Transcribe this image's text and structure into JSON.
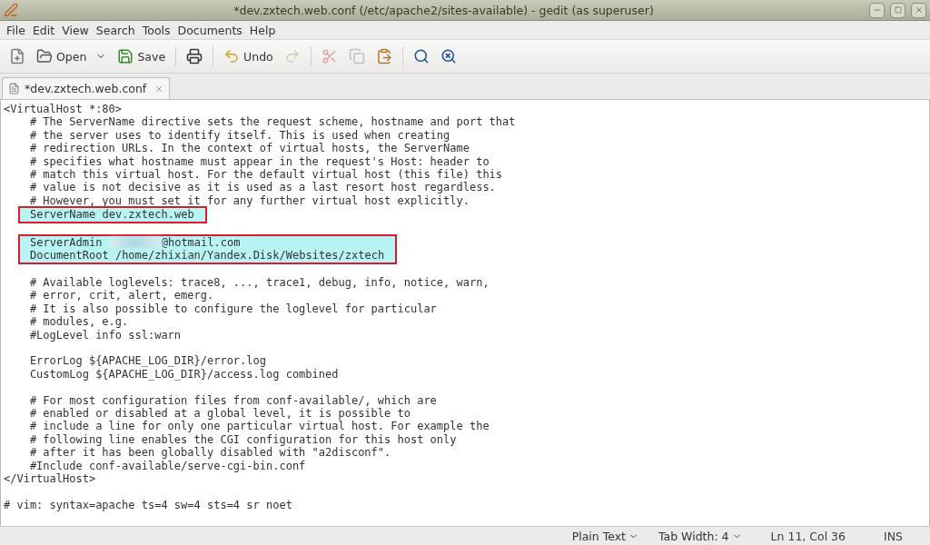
{
  "window": {
    "title": "*dev.zxtech.web.conf (/etc/apache2/sites-available) - gedit (as superuser)"
  },
  "menu": [
    "File",
    "Edit",
    "View",
    "Search",
    "Tools",
    "Documents",
    "Help"
  ],
  "toolbar": [
    {
      "kind": "new",
      "disabled": false
    },
    {
      "kind": "open",
      "label": "Open",
      "disabled": false
    },
    {
      "kind": "save",
      "label": "Save",
      "disabled": false
    },
    {
      "kind": "print",
      "disabled": false
    },
    {
      "kind": "undo",
      "label": "Undo",
      "disabled": false
    },
    {
      "kind": "redo",
      "disabled": true
    },
    {
      "kind": "cut",
      "disabled": true
    },
    {
      "kind": "copy",
      "disabled": true
    },
    {
      "kind": "paste",
      "disabled": false
    },
    {
      "kind": "find",
      "disabled": false
    },
    {
      "kind": "replace",
      "disabled": false
    }
  ],
  "tabs": [
    {
      "label": "*dev.zxtech.web.conf",
      "selected": true
    }
  ],
  "editor": {
    "blocks": [
      {
        "kind": "plain",
        "lines": [
          {
            "text": "<VirtualHost *:80>"
          },
          {
            "text": "    # The ServerName directive sets the request scheme, hostname and port that"
          },
          {
            "text": "    # the server uses to identify itself. This is used when creating"
          },
          {
            "text": "    # redirection URLs. In the context of virtual hosts, the ServerName"
          },
          {
            "text": "    # specifies what hostname must appear in the request's Host: header to"
          },
          {
            "text": "    # match this virtual host. For the default virtual host (this file) this"
          },
          {
            "text": "    # value is not decisive as it is used as a last resort host regardless."
          },
          {
            "text": "    # However, you must set it for any further virtual host explicitly."
          }
        ]
      },
      {
        "kind": "marked",
        "lines": [
          {
            "text": "ServerName dev.zxtech.web"
          }
        ]
      },
      {
        "kind": "plain",
        "lines": [
          {
            "kind": "blank"
          }
        ]
      },
      {
        "kind": "marked",
        "lines": [
          {
            "kind": "redacted",
            "before": "ServerAdmin ",
            "after": "@hotmail.com"
          },
          {
            "text": "DocumentRoot /home/zhixian/Yandex.Disk/Websites/zxtech"
          }
        ]
      },
      {
        "kind": "plain",
        "lines": [
          {
            "kind": "blank"
          },
          {
            "text": "    # Available loglevels: trace8, ..., trace1, debug, info, notice, warn,"
          },
          {
            "text": "    # error, crit, alert, emerg."
          },
          {
            "text": "    # It is also possible to configure the loglevel for particular"
          },
          {
            "text": "    # modules, e.g."
          },
          {
            "text": "    #LogLevel info ssl:warn"
          },
          {
            "kind": "blank"
          },
          {
            "text": "    ErrorLog ${APACHE_LOG_DIR}/error.log"
          },
          {
            "text": "    CustomLog ${APACHE_LOG_DIR}/access.log combined"
          },
          {
            "kind": "blank"
          },
          {
            "text": "    # For most configuration files from conf-available/, which are"
          },
          {
            "text": "    # enabled or disabled at a global level, it is possible to"
          },
          {
            "text": "    # include a line for only one particular virtual host. For example the"
          },
          {
            "text": "    # following line enables the CGI configuration for this host only"
          },
          {
            "text": "    # after it has been globally disabled with \"a2disconf\"."
          },
          {
            "text": "    #Include conf-available/serve-cgi-bin.conf"
          },
          {
            "text": "</VirtualHost>"
          },
          {
            "kind": "blank"
          },
          {
            "text": "# vim: syntax=apache ts=4 sw=4 sts=4 sr noet"
          }
        ]
      }
    ]
  },
  "status_bar": {
    "language": "Plain Text",
    "tab_width": "Tab Width: 4",
    "position": "Ln 11, Col 36",
    "mode": "INS"
  }
}
